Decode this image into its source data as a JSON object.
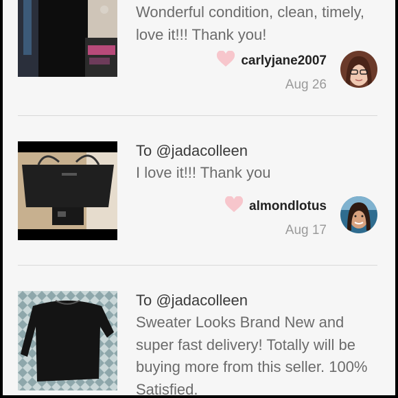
{
  "reviews": [
    {
      "to": "",
      "text": "Wonderful condition, clean, timely, love it!!! Thank you!",
      "user": "carlyjane2007",
      "date": "Aug 26"
    },
    {
      "to": "To @jadacolleen",
      "text": "I love it!!! Thank you",
      "user": "almondlotus",
      "date": "Aug 17"
    },
    {
      "to": "To @jadacolleen",
      "text": "Sweater Looks Brand New and super fast delivery! Totally will be buying more from this seller. 100% Satisfied.",
      "user": "",
      "date": ""
    }
  ],
  "icons": {
    "like": "heart-icon"
  },
  "colors": {
    "heart": "#f7c6cc",
    "username": "#222222",
    "date": "#9a9a9a",
    "body_text": "#6b6b6b"
  }
}
